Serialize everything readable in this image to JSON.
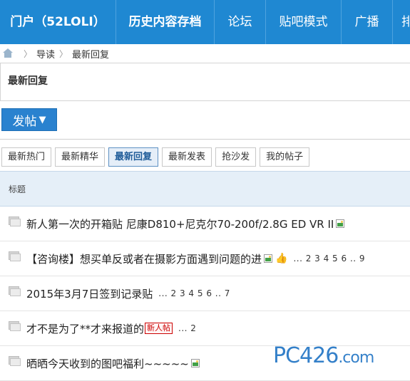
{
  "nav": {
    "items": [
      {
        "label": "门户（52LOLI）",
        "bold": true
      },
      {
        "label": "历史内容存档",
        "bold": true
      },
      {
        "label": "论坛",
        "bold": false
      },
      {
        "label": "贴吧模式",
        "bold": false
      },
      {
        "label": "广播",
        "bold": false
      },
      {
        "label": "排",
        "bold": false
      }
    ]
  },
  "breadcrumb": {
    "items": [
      "导读",
      "最新回复"
    ],
    "separator": "〉"
  },
  "heading": "最新回复",
  "post_button": {
    "label": "发帖",
    "caret": "▼"
  },
  "tabs": [
    {
      "label": "最新热门",
      "active": false
    },
    {
      "label": "最新精华",
      "active": false
    },
    {
      "label": "最新回复",
      "active": true
    },
    {
      "label": "最新发表",
      "active": false
    },
    {
      "label": "抢沙发",
      "active": false
    },
    {
      "label": "我的帖子",
      "active": false
    }
  ],
  "table": {
    "header": "标题",
    "threads": [
      {
        "title": "新人第一次的开箱贴 尼康D810+尼克尔70-200f/2.8G ED VR II",
        "has_image": true,
        "has_thumb": false,
        "pages": "",
        "badge": ""
      },
      {
        "title": "【咨询楼】想买单反或者在摄影方面遇到问题的进",
        "has_image": true,
        "has_thumb": true,
        "pages": "... 2 3 4 5 6 .. 9",
        "badge": ""
      },
      {
        "title": "2015年3月7日签到记录贴",
        "has_image": false,
        "has_thumb": false,
        "pages": "... 2 3 4 5 6 .. 7",
        "badge": ""
      },
      {
        "title": "才不是为了**才来报道的",
        "has_image": false,
        "has_thumb": false,
        "pages": "... 2",
        "badge": "新人帖"
      },
      {
        "title": "晒晒今天收到的图吧福利~~~~~",
        "has_image": true,
        "has_thumb": false,
        "pages": "",
        "badge": ""
      }
    ]
  },
  "watermark": {
    "main": "PC426",
    "suffix": ".com"
  },
  "colors": {
    "nav_bg": "#1f88d2",
    "post_btn": "#2a82cf",
    "table_header_bg": "#e5eff8",
    "watermark": "#1f73c4"
  }
}
